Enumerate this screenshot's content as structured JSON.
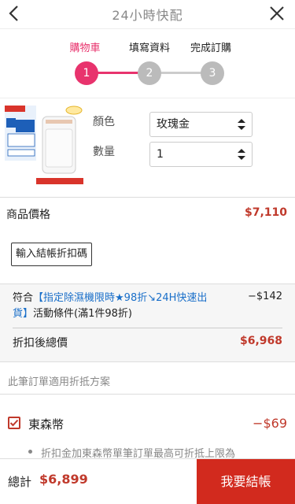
{
  "header": {
    "title": "24小時快配",
    "back_icon": "chevron-left-icon",
    "close_icon": "close-icon"
  },
  "steps": [
    {
      "label": "購物車",
      "number": "1",
      "active": true
    },
    {
      "label": "填寫資料",
      "number": "2",
      "active": false
    },
    {
      "label": "完成訂購",
      "number": "3",
      "active": false
    }
  ],
  "product": {
    "thumbnail_icon": "dehumidifier-product-image",
    "color_label": "顏色",
    "color_value": "玫瑰金",
    "quantity_label": "數量",
    "quantity_value": "1"
  },
  "summary": {
    "item_price_label": "商品價格",
    "item_price": "$7,110",
    "coupon_button": "輸入結帳折扣碼"
  },
  "promo": {
    "prefix": "符合",
    "link_text": "【指定除濕機限時★98折↘24H快速出貨】",
    "suffix": "活動條件(滿1件98折)",
    "discount": "−$142",
    "after_label": "折扣後總價",
    "after_price": "$6,968"
  },
  "offset": {
    "section_note": "此筆訂單適用折抵方案",
    "points_label": "東森幣",
    "points_discount": "−$69",
    "points_note": "折扣金加東森幣單筆訂單最高可折抵上限為"
  },
  "footer": {
    "total_label": "總計",
    "total_value": "$6,899",
    "checkout_label": "我要結帳"
  },
  "colors": {
    "accent": "#e8336d",
    "price": "#c0392b",
    "checkout": "#d22a1e",
    "link": "#1a6fc9"
  }
}
